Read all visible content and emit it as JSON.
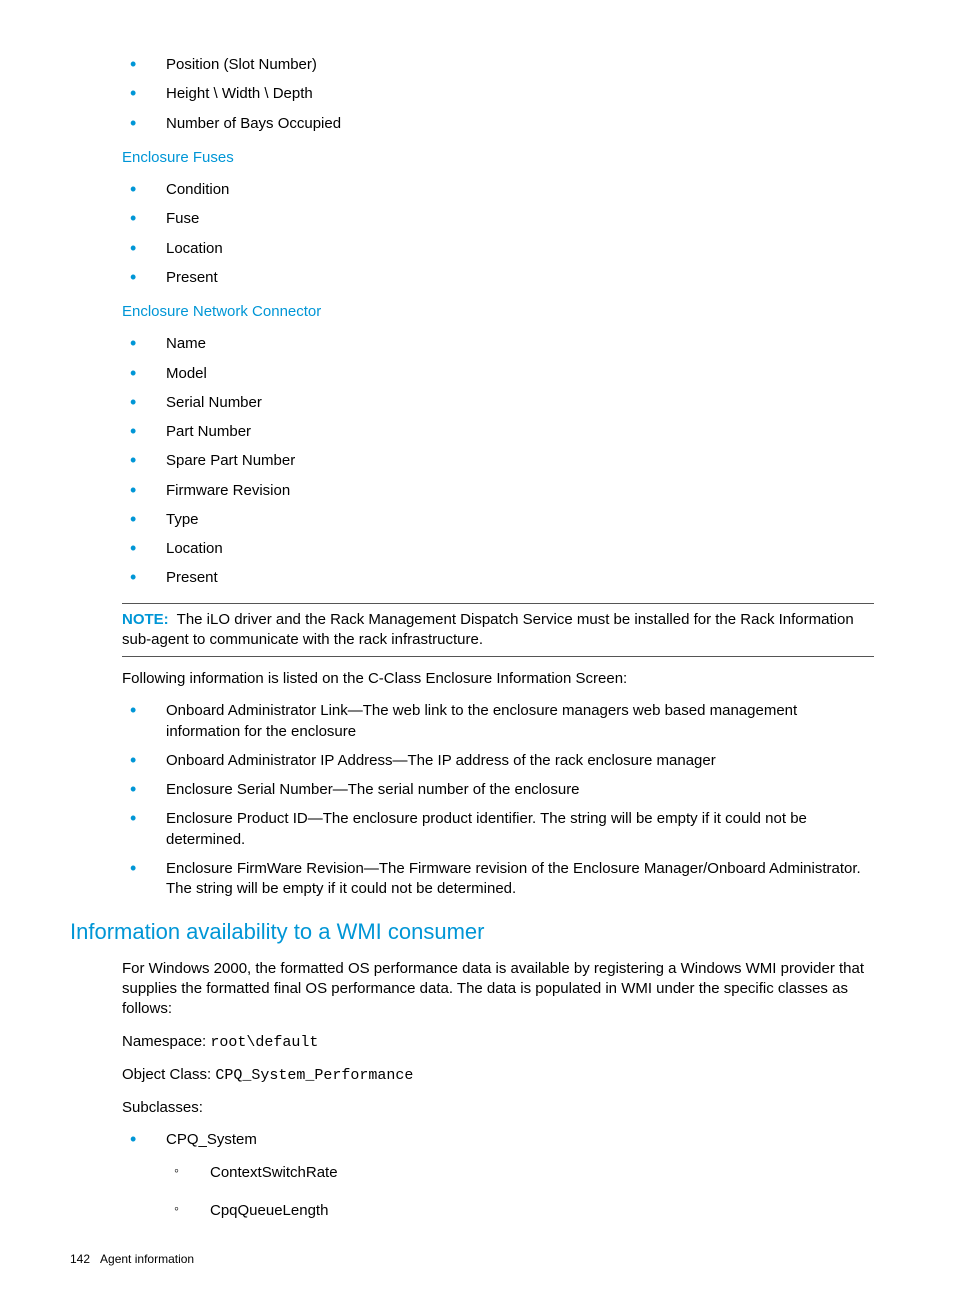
{
  "list1": {
    "items": [
      "Position (Slot Number)",
      "Height \\ Width \\ Depth",
      "Number of Bays Occupied"
    ]
  },
  "heading_fuses": "Enclosure Fuses",
  "list_fuses": {
    "items": [
      "Condition",
      "Fuse",
      "Location",
      "Present"
    ]
  },
  "heading_network": "Enclosure Network Connector",
  "list_network": {
    "items": [
      "Name",
      "Model",
      "Serial Number",
      "Part Number",
      "Spare Part Number",
      "Firmware Revision",
      "Type",
      "Location",
      "Present"
    ]
  },
  "note": {
    "label": "NOTE:",
    "text": "The iLO driver and the Rack Management Dispatch Service must be installed for the Rack Information sub-agent to communicate with the rack infrastructure."
  },
  "para_following": "Following information is listed on the C-Class Enclosure Information Screen:",
  "list_cclass": {
    "items": [
      "Onboard Administrator Link—The web link to the enclosure managers web based management information for the enclosure",
      "Onboard Administrator IP Address—The IP address of the rack enclosure manager",
      "Enclosure Serial Number—The serial number of the enclosure",
      "Enclosure Product ID—The enclosure product identifier. The string will be empty if it could not be determined.",
      "Enclosure FirmWare Revision—The Firmware revision of the Enclosure Manager/Onboard Administrator. The string will be empty if it could not be determined."
    ]
  },
  "section_heading": "Information availability to a WMI consumer",
  "para_windows": "For Windows 2000, the formatted OS performance data is available by registering a Windows WMI provider that supplies the formatted final OS performance data. The data is populated in WMI under the specific classes as follows:",
  "namespace_label": "Namespace: ",
  "namespace_value": "root\\default",
  "objclass_label": "Object Class: ",
  "objclass_value": "CPQ_System_Performance",
  "subclasses_label": "Subclasses:",
  "subclass_main": "CPQ_System",
  "subclass_items": [
    "ContextSwitchRate",
    "CpqQueueLength"
  ],
  "footer": {
    "page": "142",
    "title": "Agent information"
  }
}
